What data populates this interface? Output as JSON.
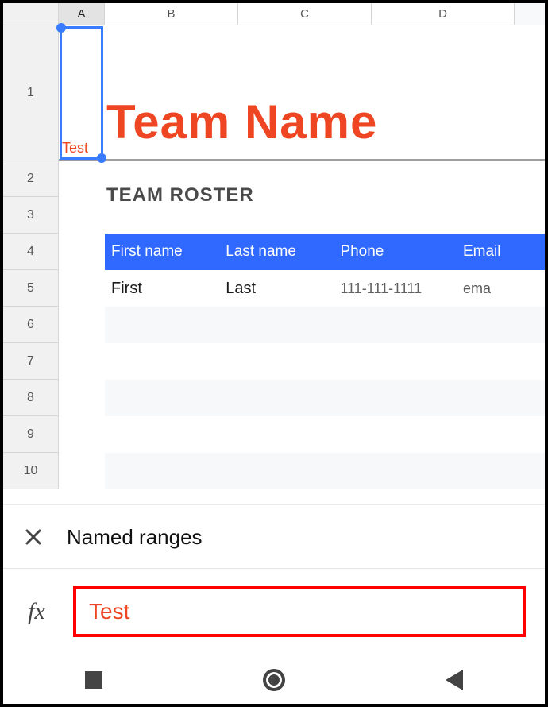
{
  "columns": [
    "A",
    "B",
    "C",
    "D"
  ],
  "rows": [
    "1",
    "2",
    "3",
    "4",
    "5",
    "6",
    "7",
    "8",
    "9",
    "10"
  ],
  "selected_cell": {
    "ref": "A1",
    "value": "Test"
  },
  "title": "Team Name",
  "section_title": "TEAM ROSTER",
  "table": {
    "headers": [
      "First name",
      "Last name",
      "Phone",
      "Email"
    ],
    "rows": [
      {
        "first": "First",
        "last": "Last",
        "phone": "111-111-1111",
        "email": "ema"
      }
    ]
  },
  "panel": {
    "title": "Named ranges",
    "fx_label": "fx",
    "name_value": "Test"
  }
}
